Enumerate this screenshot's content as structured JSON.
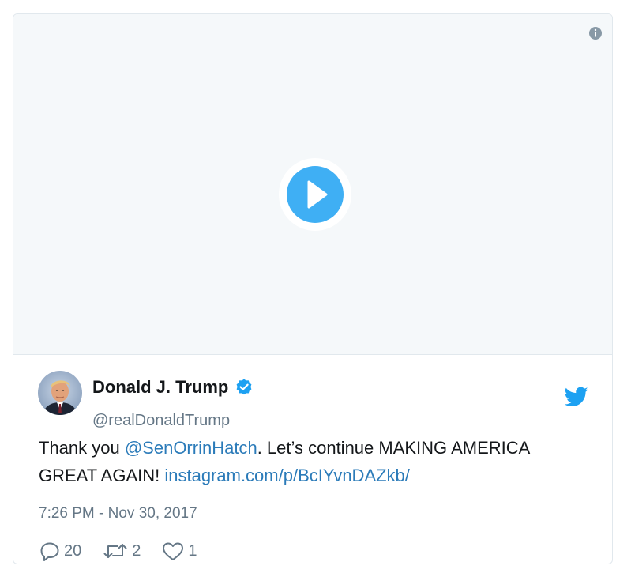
{
  "colors": {
    "brand_blue": "#1da1f2",
    "link": "#2b7bb9",
    "text_primary": "#14171a",
    "text_secondary": "#657786",
    "media_bg": "#f5f8fa",
    "border": "#e1e8ed"
  },
  "media": {
    "type": "video",
    "info_icon": "info-icon",
    "play_icon": "play-icon"
  },
  "author": {
    "name": "Donald J. Trump",
    "handle": "@realDonaldTrump",
    "verified": true,
    "avatar_icon": "avatar"
  },
  "tweet": {
    "text_before": "Thank you ",
    "mention": "@SenOrrinHatch",
    "text_after": ". Let’s continue MAKING AMERICA GREAT AGAIN! ",
    "link": "instagram.com/p/BcIYvnDAZkb/",
    "timestamp": "7:26 PM - Nov 30, 2017"
  },
  "actions": {
    "replies": "20",
    "retweets": "2",
    "likes": "1"
  }
}
